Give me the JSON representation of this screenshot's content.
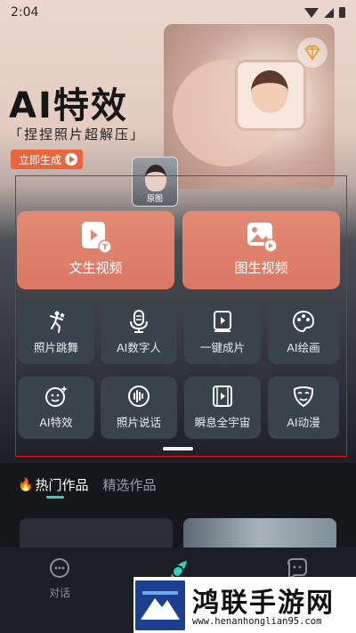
{
  "status_bar": {
    "time": "2:04"
  },
  "banner": {
    "title": "AI特效",
    "subtitle": "「捏捏照片超解压」",
    "cta_label": "立即生成",
    "thumbnail_caption": "原图"
  },
  "tools": {
    "primary": [
      {
        "label": "文生视频",
        "icon": "text-to-video-icon"
      },
      {
        "label": "图生视频",
        "icon": "image-to-video-icon"
      }
    ],
    "grid": [
      {
        "label": "照片跳舞",
        "icon": "dance-icon"
      },
      {
        "label": "AI数字人",
        "icon": "microphone-icon"
      },
      {
        "label": "一键成片",
        "icon": "video-book-icon"
      },
      {
        "label": "AI绘画",
        "icon": "palette-icon"
      },
      {
        "label": "AI特效",
        "icon": "face-sparkle-icon"
      },
      {
        "label": "照片说话",
        "icon": "voice-wave-icon"
      },
      {
        "label": "瞬息全宇宙",
        "icon": "film-strip-icon"
      },
      {
        "label": "AI动漫",
        "icon": "mask-icon"
      }
    ]
  },
  "feed": {
    "tabs": [
      {
        "label": "热门作品",
        "active": true
      },
      {
        "label": "精选作品",
        "active": false
      }
    ]
  },
  "bottom_nav": {
    "items": [
      {
        "label": "对话",
        "icon": "chat-icon"
      },
      {
        "label": "",
        "icon": "create-icon"
      },
      {
        "label": "",
        "icon": "message-icon"
      }
    ]
  },
  "watermark": {
    "text": "鸿联手游网",
    "url": "www.henanhonglian95.com"
  },
  "colors": {
    "accent": "#e38a74",
    "tile": "#3b434a",
    "highlight_box": "#e0141e",
    "cta": "#e8663c",
    "tab_indicator": "#35d0c0"
  }
}
